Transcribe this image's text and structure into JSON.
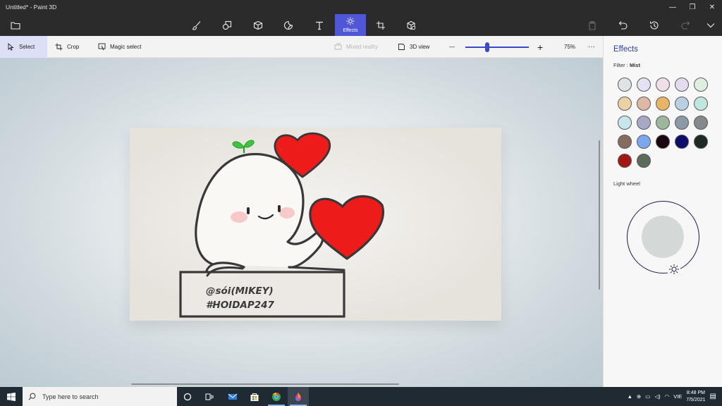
{
  "window": {
    "title": "Untitled* - Paint 3D",
    "controls": {
      "minimize": "—",
      "maximize": "❐",
      "close": "✕"
    }
  },
  "ribbon": {
    "active_tab_label": "Effects",
    "tabs": [
      "menu",
      "brushes",
      "2d-shapes",
      "3d-shapes",
      "stickers",
      "text",
      "effects",
      "canvas",
      "3d-library"
    ],
    "actions": [
      "paste",
      "undo",
      "history",
      "redo",
      "expand"
    ]
  },
  "toolbar": {
    "select_label": "Select",
    "crop_label": "Crop",
    "magic_select_label": "Magic select",
    "mixed_reality_label": "Mixed reality",
    "view_3d_label": "3D view",
    "zoom_minus": "—",
    "zoom_plus": "+",
    "zoom_level": "75%",
    "more": "···",
    "zoom_position": 0.34
  },
  "canvas": {
    "line1": "@sói(MIKEY)",
    "line2": "#HOIDAP247",
    "colors": {
      "heart": "#ee1b1b",
      "outline": "#383838",
      "sprout": "#3fc43f",
      "cheek": "#f6bdbd"
    }
  },
  "panel": {
    "title": "Effects",
    "filter_label": "Filter :",
    "filter_value": "Mist",
    "swatches": [
      "#dfe3e8",
      "#e2e2f2",
      "#efdfe9",
      "#e6dbee",
      "#dcf0dd",
      "#ead2a4",
      "#ddb9a5",
      "#e9b564",
      "#b9cfe4",
      "#bfe6e0",
      "#c7e6ea",
      "#a7a8c4",
      "#9cb79c",
      "#8c9aa8",
      "#85898c",
      "#856c5d",
      "#7ba7ef",
      "#1a0712",
      "#0d0e6c",
      "#1e2a24",
      "#a31616",
      "#5b6b5c"
    ],
    "light_wheel_label": "Light wheel",
    "wheel_color": "#d4d9d8"
  },
  "taskbar": {
    "search_placeholder": "Type here to search",
    "apps": [
      "task-view",
      "file-explorer",
      "mail",
      "store",
      "chrome",
      "paint-3d"
    ],
    "language": "VIE",
    "time": "8:48 PM",
    "date": "7/5/2021"
  }
}
